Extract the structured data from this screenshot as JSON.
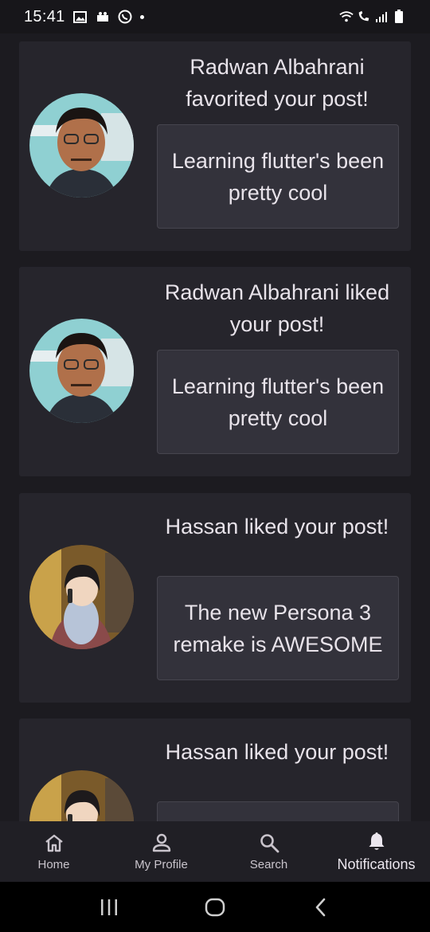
{
  "status_bar": {
    "time": "15:41",
    "left_icons": [
      "gallery-icon",
      "teams-icon",
      "whatsapp-icon",
      "dot-icon"
    ],
    "right_icons": [
      "wifi-icon",
      "call-icon",
      "signal-icon",
      "battery-icon"
    ]
  },
  "notifications": [
    {
      "avatar": "radwan-avatar",
      "title": "Radwan Albahrani favorited your post!",
      "post": "Learning flutter's been pretty cool"
    },
    {
      "avatar": "radwan-avatar",
      "title": "Radwan Albahrani liked your post!",
      "post": "Learning flutter's been pretty cool"
    },
    {
      "avatar": "hassan-avatar",
      "title": "Hassan liked your post!",
      "post": "The new Persona 3 remake is AWESOME"
    },
    {
      "avatar": "hassan-avatar",
      "title": "Hassan liked your post!",
      "post": ""
    }
  ],
  "bottom_nav": {
    "items": [
      {
        "label": "Home",
        "icon": "home-icon"
      },
      {
        "label": "My Profile",
        "icon": "person-icon"
      },
      {
        "label": "Search",
        "icon": "search-icon"
      },
      {
        "label": "Notifications",
        "icon": "bell-icon",
        "active": true
      }
    ]
  },
  "colors": {
    "background": "#1c1b20",
    "card": "#26252c",
    "post_box": "#33323b",
    "nav": "#201f25"
  }
}
